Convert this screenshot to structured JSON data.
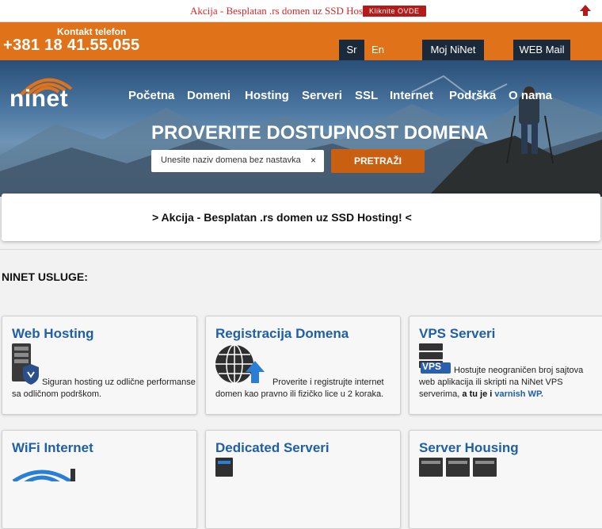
{
  "topbar": {
    "promo": "Akcija - Besplatan .rs domen uz SSD Hosting!",
    "klik": "Kliknite OVDE"
  },
  "contact": {
    "label": "Kontakt telefon",
    "phone": "+381 18 41.55.055"
  },
  "header_buttons": {
    "sr": "Sr",
    "en": "En",
    "moj": "Moj NiNet",
    "webmail": "WEB Mail"
  },
  "logo": {
    "text": "ninet"
  },
  "nav": [
    "Početna",
    "Domeni",
    "Hosting",
    "Serveri",
    "SSL",
    "Internet",
    "Podrška",
    "O nama"
  ],
  "hero": {
    "headline": "PROVERITE DOSTUPNOST DOMENA",
    "search_placeholder": "Unesite naziv domena bez nastavka",
    "clear": "×",
    "search_button": "PRETRAŽI"
  },
  "banner": {
    "text": "> Akcija - Besplatan .rs domen uz SSD Hosting! <"
  },
  "services_title": "NINET USLUGE:",
  "cards": {
    "web_hosting": {
      "title": "Web Hosting",
      "desc1": "Siguran hosting uz odlične performanse",
      "desc2": "sa odličnom podrškom."
    },
    "registracija": {
      "title": "Registracija Domena",
      "desc1": "Proverite i registrujte internet",
      "desc2": "domen kao pravno ili fizičko lice u 2 koraka."
    },
    "vps": {
      "title": "VPS Serveri",
      "badge": "VPS",
      "desc1": "Hostujte neograničen broj sajtova",
      "desc2": "web aplikacija ili skripti na NiNet VPS",
      "desc3a": "serverima,",
      "desc3b": "a tu je i",
      "desc3c": "varnish WP."
    },
    "wifi": {
      "title": "WiFi Internet"
    },
    "dedicated": {
      "title": "Dedicated Serveri"
    },
    "housing": {
      "title": "Server Housing"
    }
  }
}
